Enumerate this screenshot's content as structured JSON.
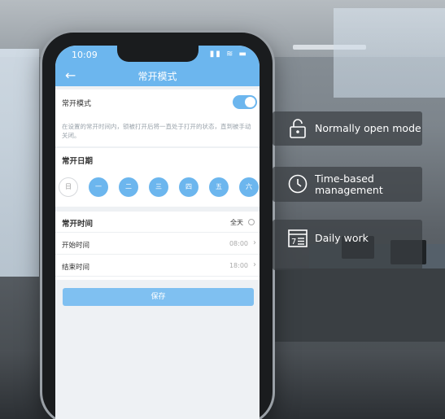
{
  "status": {
    "time": "10:09",
    "icons": "▮▮ ≋ ▬"
  },
  "nav": {
    "back": "←",
    "title": "常开模式"
  },
  "mode": {
    "label": "常开模式",
    "enabled": true,
    "description": "在设置的常开时间内，锁被打开后将一直处于打开的状态，直到被手动关闭。"
  },
  "dates": {
    "label": "常开日期",
    "days": [
      "日",
      "一",
      "二",
      "三",
      "四",
      "五",
      "六"
    ]
  },
  "time": {
    "label": "常开时间",
    "all_day": "全天",
    "start_label": "开始时间",
    "start_value": "08:00",
    "end_label": "结束时间",
    "end_value": "18:00"
  },
  "save_label": "保存",
  "features": [
    {
      "icon": "lock-icon",
      "text": "Normally open mode"
    },
    {
      "icon": "clock-icon",
      "text": "Time-based management"
    },
    {
      "icon": "calendar-icon",
      "text": "Daily work"
    }
  ],
  "colors": {
    "accent": "#6cb6ee"
  }
}
